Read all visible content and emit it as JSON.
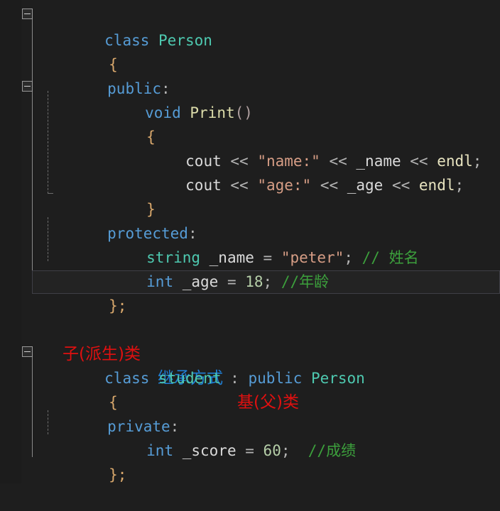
{
  "editor": {
    "language": "cpp",
    "background": "#1e1e1e",
    "current_line_index": 11,
    "colors": {
      "keyword": "#569cd6",
      "type": "#4ec9b0",
      "function": "#dcdcaa",
      "string": "#d69d85",
      "number": "#b5cea8",
      "comment": "#3ca03c",
      "identifier": "#dadada",
      "annotation_red": "#e01010",
      "annotation_blue": "#1f7fd6"
    }
  },
  "lines": {
    "l1_class": "class",
    "l1_name": "Person",
    "l2_brace": "{",
    "l3_public": "public",
    "l3_colon": ":",
    "l4_void": "void",
    "l4_print": "Print",
    "l4_parens": "()",
    "l5_brace": "{",
    "l6_cout": "cout",
    "l6_op1": " << ",
    "l6_str": "\"name:\"",
    "l6_op2": " << ",
    "l6_var": "_name",
    "l6_op3": " << ",
    "l6_endl": "endl",
    "l6_semi": ";",
    "l7_cout": "cout",
    "l7_op1": " << ",
    "l7_str": "\"age:\"",
    "l7_op2": " << ",
    "l7_var": "_age",
    "l7_op3": " << ",
    "l7_endl": "endl",
    "l7_semi": ";",
    "l8_brace": "}",
    "l9_protected": "protected",
    "l9_colon": ":",
    "l10_type": "string",
    "l10_var": " _name ",
    "l10_eq": "= ",
    "l10_str": "\"peter\"",
    "l10_semi": "; ",
    "l10_comment": "// 姓名",
    "l11_type": "int",
    "l11_var": " _age ",
    "l11_eq": "= ",
    "l11_num": "18",
    "l11_semi": "; ",
    "l11_comment": "//年龄",
    "l12_close": "};",
    "l14_annot_child": "子(派生)类",
    "l14_annot_mode": "继承方式",
    "l14_annot_base": "基(父)类",
    "l15_class": "class",
    "l15_name": " student ",
    "l15_colon": ": ",
    "l15_public": "public",
    "l15_base": " Person",
    "l16_brace": "{",
    "l17_private": "private",
    "l17_colon": ":",
    "l18_type": "int",
    "l18_var": " _score ",
    "l18_eq": "= ",
    "l18_num": "60",
    "l18_semi": ";  ",
    "l18_comment": "//成绩",
    "l19_close": "};"
  },
  "fold_markers": {
    "marker_class_person": "collapse-minus",
    "marker_print_method": "collapse-minus",
    "marker_class_student": "collapse-minus"
  }
}
